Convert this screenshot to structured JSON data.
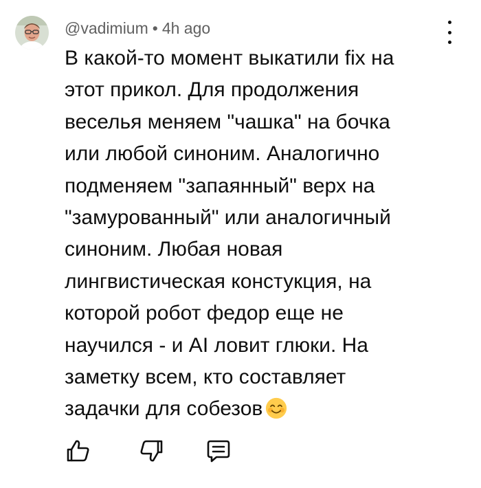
{
  "comment": {
    "author": "@vadimium",
    "separator": "•",
    "time": "4h ago",
    "lines": [
      "В какой-то момент выкатили fix на",
      "этот прикол. Для продолжения",
      "веселья меняем \"чашка\" на бочка",
      "или любой синоним. Аналогично",
      "подменяем \"запаянный\" верх на",
      "\"замурованный\" или аналогичный",
      "синоним. Любая новая",
      "лингвистическая констукция, на",
      "которой робот федор еще не",
      "научился - и AI ловит глюки. На",
      "заметку всем, кто составляет",
      "задачки для собезов"
    ],
    "emoji": "smiling-face-emoji"
  },
  "icons": {
    "menu": "more-vert-icon",
    "like": "thumbs-up-icon",
    "dislike": "thumbs-down-icon",
    "reply": "reply-comment-icon"
  },
  "colors": {
    "text": "#0f0f0f",
    "meta": "#606060",
    "emoji_face": "#FFCC4D",
    "emoji_cheeks": "#F4900C",
    "avatar_bg": "#d8dfd3"
  }
}
